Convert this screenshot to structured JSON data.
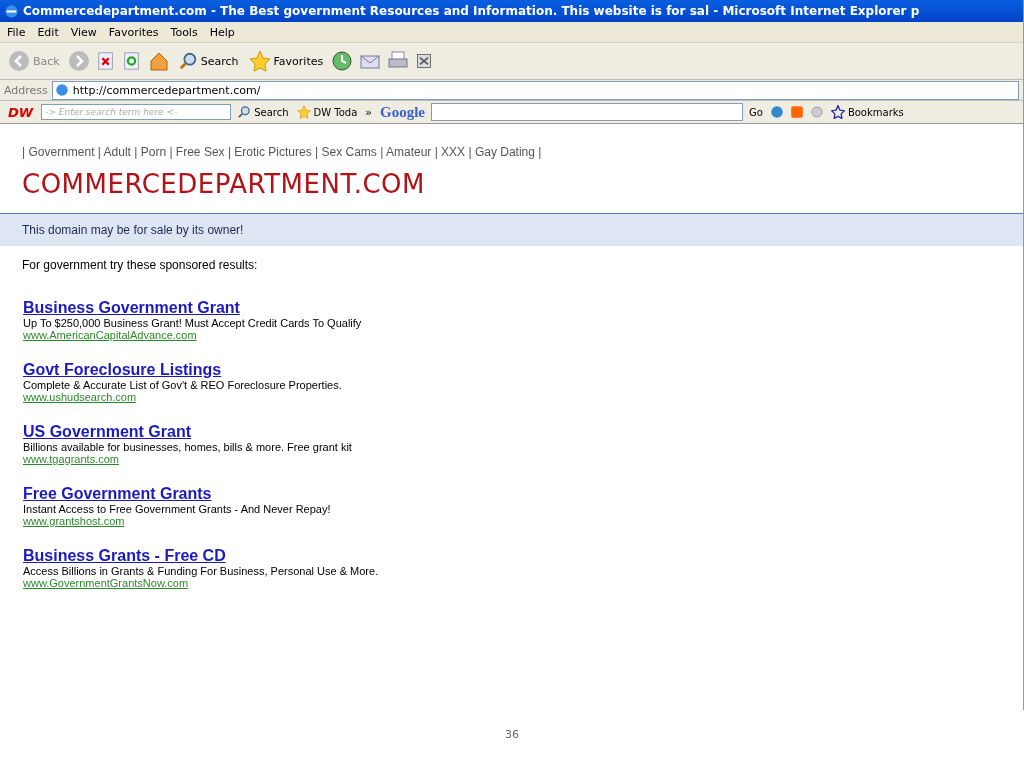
{
  "window": {
    "title": "Commercedepartment.com - The Best government Resources and Information. This website is for sal - Microsoft Internet Explorer p"
  },
  "menu": [
    "File",
    "Edit",
    "View",
    "Favorites",
    "Tools",
    "Help"
  ],
  "toolbar": {
    "back": "Back",
    "search": "Search",
    "favorites": "Favorites"
  },
  "address": {
    "label": "Address",
    "value": "http://commercedepartment.com/"
  },
  "dw_toolbar": {
    "logo": "DW",
    "search_placeholder": "-> Enter search term here <-",
    "search": "Search",
    "today": "DW Toda",
    "chevron": "»",
    "google": "Google",
    "go": "Go",
    "bookmarks": "Bookmarks"
  },
  "page": {
    "nav": "| Government | Adult | Porn | Free Sex | Erotic Pictures | Sex Cams | Amateur | XXX | Gay Dating |",
    "heading": "COMMERCEDEPARTMENT.COM",
    "sale_notice": "This domain may be for sale by its owner!",
    "intro": "For government try these sponsored results:",
    "results": [
      {
        "title": "Business Government Grant",
        "description": "Up To $250,000 Business Grant! Must Accept Credit Cards To Qualify",
        "url": "www.AmericanCapitalAdvance.com"
      },
      {
        "title": "Govt Foreclosure Listings",
        "description": "Complete & Accurate List of Gov't & REO Foreclosure Properties.",
        "url": "www.ushudsearch.com"
      },
      {
        "title": "US Government Grant",
        "description": "Billions available for businesses, homes, bills & more. Free grant kit",
        "url": "www.tgagrants.com"
      },
      {
        "title": "Free Government Grants",
        "description": "Instant Access to Free Government Grants - And Never Repay!",
        "url": "www.grantshost.com"
      },
      {
        "title": "Business Grants - Free CD",
        "description": "Access Billions in Grants & Funding For Business, Personal Use & More.",
        "url": "www.GovernmentGrantsNow.com"
      }
    ]
  },
  "page_number": "36"
}
